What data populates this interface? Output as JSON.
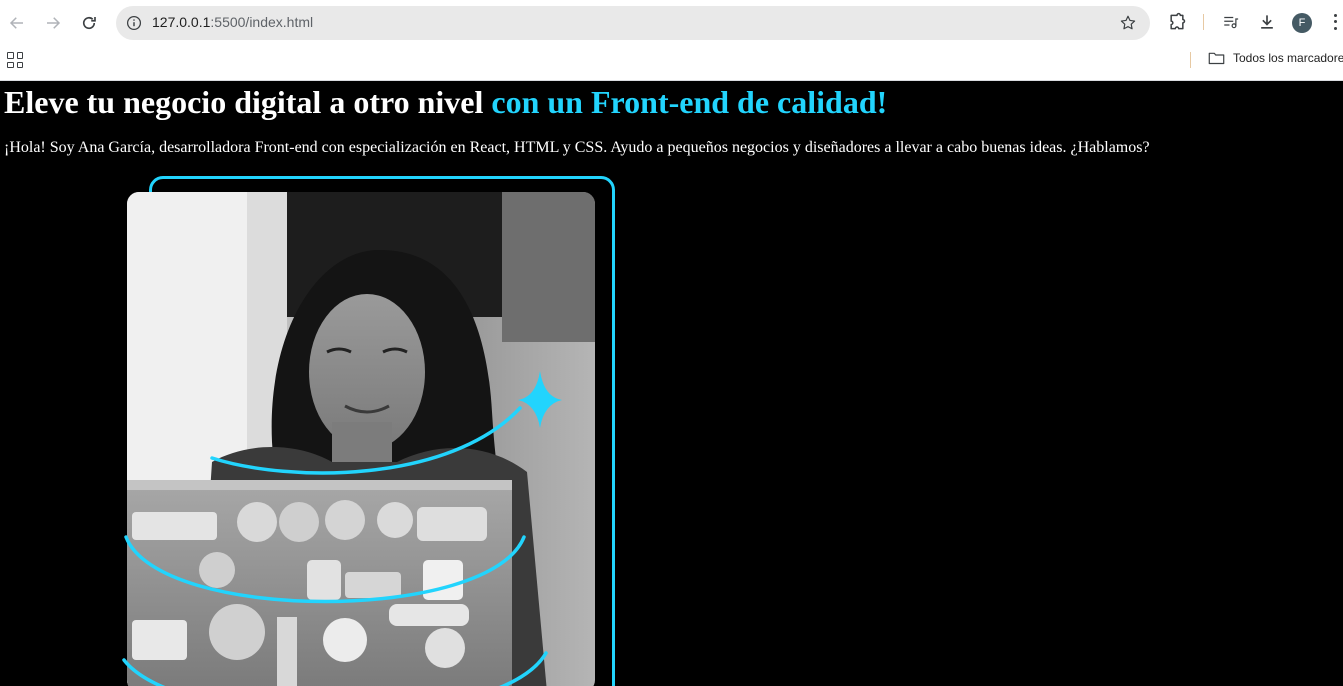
{
  "browser": {
    "url_host": "127.0.0.1",
    "url_path": ":5500/index.html",
    "profile_initial": "F",
    "bookmark_folder": "Todos los marcadores"
  },
  "icons": {
    "back": "arrow-left-icon",
    "forward": "arrow-right-icon",
    "reload": "reload-icon",
    "site_info": "info-icon",
    "bookmark_star": "star-icon",
    "extensions": "puzzle-icon",
    "media": "media-queue-icon",
    "downloads": "download-icon",
    "menu": "kebab-menu-icon",
    "apps": "apps-grid-icon",
    "folder": "folder-icon"
  },
  "hero": {
    "headline_main": "Eleve tu negocio digital a otro nivel",
    "headline_accent": "con un Front-end de calidad!",
    "intro": "¡Hola! Soy Ana García, desarrolladora Front-end con especialización en React, HTML y CSS. Ayudo a pequeños negocios y diseñadores a llevar a cabo buenas ideas. ¿Hablamos?"
  },
  "colors": {
    "accent": "#22d4fd",
    "page_background": "#000000",
    "text": "#ffffff"
  }
}
